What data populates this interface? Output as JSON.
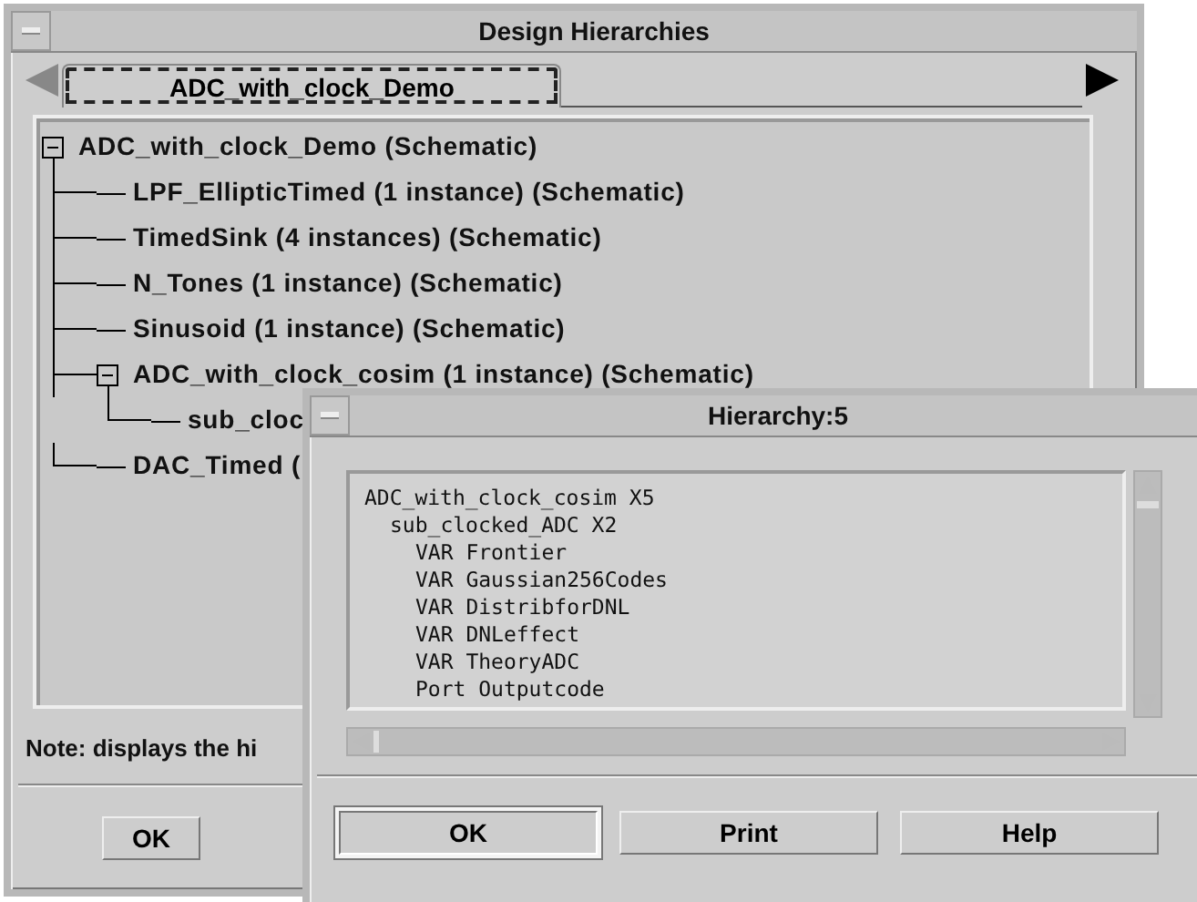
{
  "main_window": {
    "title": "Design Hierarchies",
    "tabs": [
      {
        "label": "ADC_with_clock_Demo",
        "selected": true
      }
    ],
    "tree": [
      {
        "label": "ADC_with_clock_Demo (Schematic)",
        "expanded": true,
        "children": [
          {
            "label": "LPF_EllipticTimed (1 instance) (Schematic)"
          },
          {
            "label": "TimedSink (4 instances) (Schematic)"
          },
          {
            "label": "N_Tones (1 instance) (Schematic)"
          },
          {
            "label": "Sinusoid (1 instance) (Schematic)"
          },
          {
            "label": "ADC_with_clock_cosim (1 instance) (Schematic)",
            "expanded": true,
            "children": [
              {
                "label": "sub_cloc"
              }
            ]
          },
          {
            "label": "DAC_Timed ("
          }
        ]
      }
    ],
    "note": "Note: displays the hi",
    "buttons": [
      "OK"
    ]
  },
  "hierarchy_window": {
    "title": "Hierarchy:5",
    "listing": [
      {
        "text": "ADC_with_clock_cosim X5",
        "children": [
          {
            "text": "sub_clocked_ADC X2",
            "children": [
              {
                "text": "VAR Frontier"
              },
              {
                "text": "VAR Gaussian256Codes"
              },
              {
                "text": "VAR DistribforDNL"
              },
              {
                "text": "VAR DNLeffect"
              },
              {
                "text": "VAR TheoryADC"
              },
              {
                "text": "Port Outputcode"
              }
            ]
          }
        ]
      }
    ],
    "buttons": [
      {
        "label": "OK",
        "default": true
      },
      {
        "label": "Print",
        "default": false
      },
      {
        "label": "Help",
        "default": false
      }
    ]
  }
}
